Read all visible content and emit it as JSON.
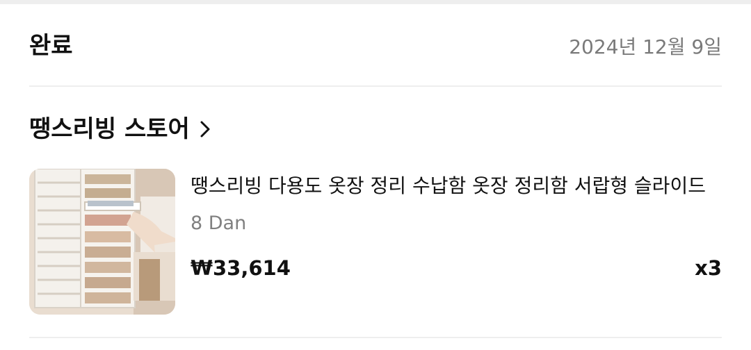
{
  "order": {
    "status": "완료",
    "date": "2024년 12월 9일"
  },
  "store": {
    "name": "땡스리빙 스토어",
    "chevron_icon": "chevron-right-icon"
  },
  "item": {
    "title": "땡스리빙 다용도 옷장 정리 수납함 옷장 정리함 서랍형 슬라이드",
    "option": "8 Dan",
    "price": "₩33,614",
    "quantity": "x3",
    "thumbnail": "product-image"
  },
  "colors": {
    "muted_text": "#7a7a7a",
    "divider": "#eeeeee",
    "primary_text": "#111111"
  }
}
